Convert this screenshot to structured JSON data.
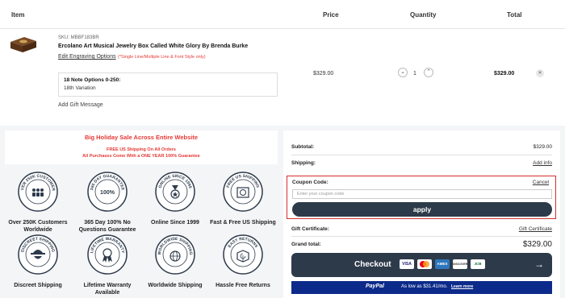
{
  "header": {
    "item": "Item",
    "price": "Price",
    "quantity": "Quantity",
    "total": "Total"
  },
  "cart_item": {
    "sku": "SKU: MBBF183BR",
    "name": "Ercolano Art Musical Jewelry Box Called White Glory By Brenda Burke",
    "edit_engraving": "Edit Engraving Options",
    "engraving_note": "(*Single Line/Multiple Line & Font Style only)",
    "option_title": "18 Note Options 0-250:",
    "option_value": "18th Variation",
    "add_gift": "Add Gift Message",
    "price": "$329.00",
    "quantity": "1",
    "total": "$329.00"
  },
  "promo": {
    "title": "Big Holiday Sale Across Entire Website",
    "line1": "FREE US Shipping On All Orders",
    "line2": "All Purchases Come With a ONE YEAR 100% Guarantee"
  },
  "badges": [
    {
      "ring": "OVER 250K CUSTOMERS",
      "center": "",
      "label": "Over 250K Customers Worldwide"
    },
    {
      "ring": "365 DAY GUARANTEE",
      "center": "100%",
      "label": "365 Day 100% No Questions Guarantee"
    },
    {
      "ring": "ONLINE SINCE 1999",
      "center": "",
      "label": "Online Since 1999"
    },
    {
      "ring": "FREE US SHIPPING",
      "center": "",
      "label": "Fast & Free US Shipping"
    },
    {
      "ring": "DISCREET SHIPPING",
      "center": "",
      "label": "Discreet Shipping"
    },
    {
      "ring": "LIFETIME WARRANTY",
      "center": "",
      "label": "Lifetime Warranty Available"
    },
    {
      "ring": "WORLDWIDE SHIPPING",
      "center": "",
      "label": "Worldwide Shipping"
    },
    {
      "ring": "EASY RETURNS",
      "center": "",
      "label": "Hassle Free Returns"
    }
  ],
  "summary": {
    "subtotal_label": "Subtotal:",
    "subtotal_value": "$329.00",
    "shipping_label": "Shipping:",
    "shipping_link": "Add info",
    "coupon_label": "Coupon Code:",
    "coupon_cancel": "Cancel",
    "coupon_placeholder": "Enter your coupon code",
    "apply_label": "apply",
    "gift_label": "Gift Certificate:",
    "gift_link": "Gift Certificate",
    "grand_label": "Grand total:",
    "grand_value": "$329.00",
    "checkout_label": "Checkout",
    "cards": [
      "VISA",
      "",
      "AMEX",
      "DISCOVER",
      "JCB"
    ],
    "paypal_brand": "PayPal",
    "paypal_text": "As low as $31.41/mo.",
    "paypal_link": "Learn more"
  },
  "colors": {
    "accent_red": "#e53935",
    "button_navy": "#2d3a4a",
    "paypal_blue": "#0b2a8a"
  }
}
